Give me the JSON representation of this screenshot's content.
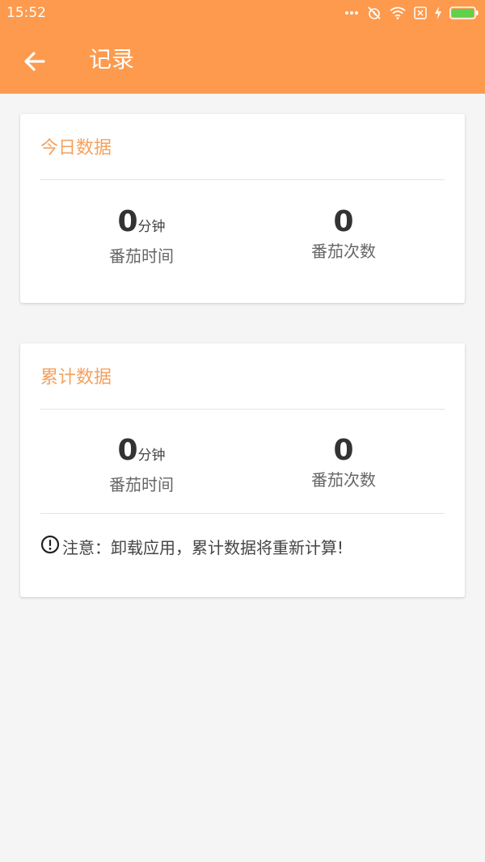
{
  "status_bar": {
    "time": "15:52",
    "icons": [
      "more-icon",
      "alarm-off-icon",
      "wifi-icon",
      "sim-icon",
      "charging-icon",
      "battery-icon"
    ]
  },
  "toolbar": {
    "back_icon": "arrow-left-icon",
    "title": "记录"
  },
  "colors": {
    "accent": "#fe9a4d",
    "card_title": "#f4a15d",
    "background": "#f5f5f5"
  },
  "today_card": {
    "title": "今日数据",
    "time_value": "0",
    "time_unit": "分钟",
    "time_label": "番茄时间",
    "count_value": "0",
    "count_label": "番茄次数"
  },
  "total_card": {
    "title": "累计数据",
    "time_value": "0",
    "time_unit": "分钟",
    "time_label": "番茄时间",
    "count_value": "0",
    "count_label": "番茄次数",
    "notice_icon": "exclamation-circle-icon",
    "notice": "注意：卸载应用，累计数据将重新计算!"
  }
}
